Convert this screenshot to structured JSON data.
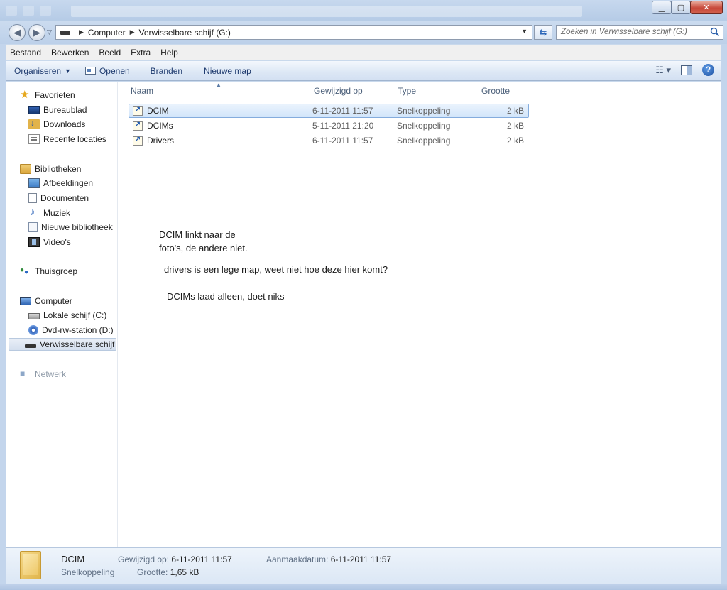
{
  "window": {
    "minimize_label": "▁",
    "maximize_label": "▢",
    "close_label": "✕"
  },
  "address": {
    "crumbs": [
      "Computer",
      "Verwisselbare schijf (G:)"
    ]
  },
  "search": {
    "placeholder": "Zoeken in Verwisselbare schijf (G:)"
  },
  "menu": [
    "Bestand",
    "Bewerken",
    "Beeld",
    "Extra",
    "Help"
  ],
  "toolbar": {
    "organize": "Organiseren",
    "open": "Openen",
    "burn": "Branden",
    "new_folder": "Nieuwe map"
  },
  "nav": {
    "favorites": "Favorieten",
    "desktop": "Bureaublad",
    "downloads": "Downloads",
    "recent": "Recente locaties",
    "libraries": "Bibliotheken",
    "pictures": "Afbeeldingen",
    "documents": "Documenten",
    "music": "Muziek",
    "new_library": "Nieuwe bibliotheek",
    "videos": "Video's",
    "homegroup": "Thuisgroep",
    "computer": "Computer",
    "local_disk": "Lokale schijf (C:)",
    "dvd": "Dvd-rw-station (D:)",
    "removable": "Verwisselbare schijf",
    "network": "Netwerk"
  },
  "columns": {
    "name": "Naam",
    "modified": "Gewijzigd op",
    "type": "Type",
    "size": "Grootte"
  },
  "files": [
    {
      "name": "DCIM",
      "modified": "6-11-2011 11:57",
      "type": "Snelkoppeling",
      "size": "2 kB"
    },
    {
      "name": "DCIMs",
      "modified": "5-11-2011 21:20",
      "type": "Snelkoppeling",
      "size": "2 kB"
    },
    {
      "name": "Drivers",
      "modified": "6-11-2011 11:57",
      "type": "Snelkoppeling",
      "size": "2 kB"
    }
  ],
  "notes": {
    "line1": "DCIM linkt naar de",
    "line2": "foto's, de andere niet.",
    "line3": "drivers is een lege map, weet niet hoe deze hier komt?",
    "line4": "DCIMs laad alleen, doet niks"
  },
  "details": {
    "name": "DCIM",
    "kind": "Snelkoppeling",
    "modified_label": "Gewijzigd op:",
    "modified_value": "6-11-2011 11:57",
    "size_label": "Grootte:",
    "size_value": "1,65 kB",
    "created_label": "Aanmaakdatum:",
    "created_value": "6-11-2011 11:57"
  }
}
